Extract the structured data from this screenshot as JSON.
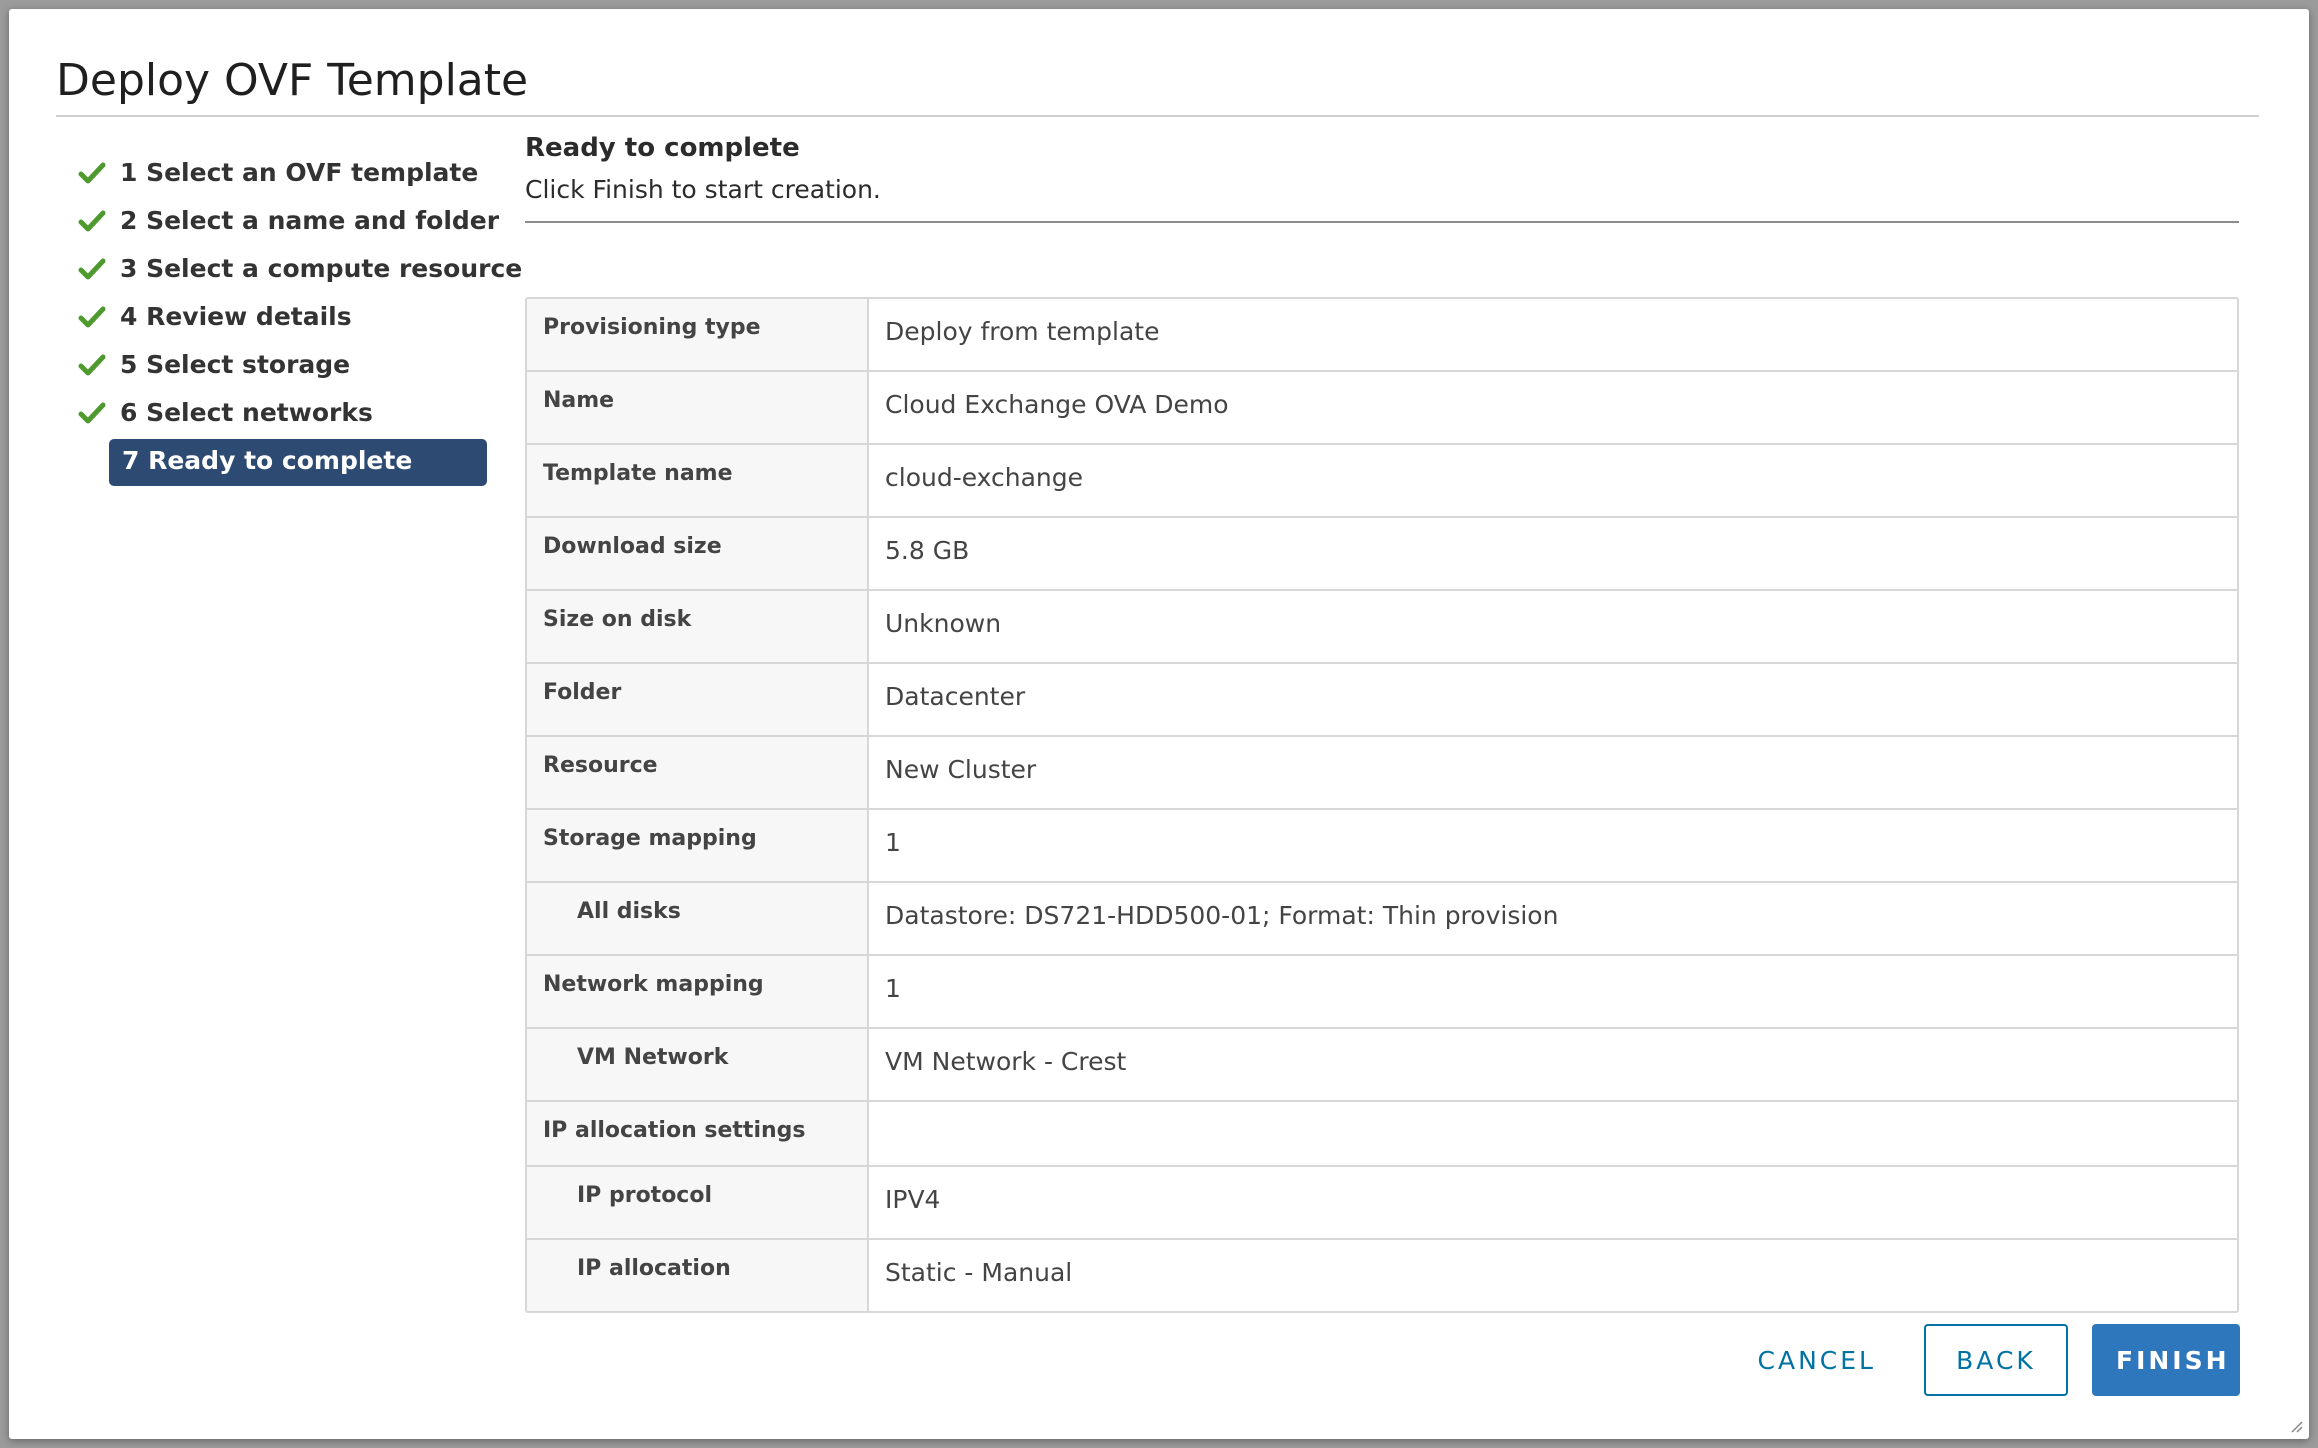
{
  "dialog": {
    "title": "Deploy OVF Template"
  },
  "steps": [
    {
      "label": "1 Select an OVF template",
      "done": true
    },
    {
      "label": "2 Select a name and folder",
      "done": true
    },
    {
      "label": "3 Select a compute resource",
      "done": true
    },
    {
      "label": "4 Review details",
      "done": true
    },
    {
      "label": "5 Select storage",
      "done": true
    },
    {
      "label": "6 Select networks",
      "done": true
    },
    {
      "label": "7 Ready to complete",
      "done": false,
      "active": true
    }
  ],
  "section": {
    "title": "Ready to complete",
    "subtitle": "Click Finish to start creation."
  },
  "summary": [
    {
      "key": "Provisioning type",
      "value": "Deploy from template"
    },
    {
      "key": "Name",
      "value": "Cloud Exchange OVA Demo"
    },
    {
      "key": "Template name",
      "value": "cloud-exchange"
    },
    {
      "key": "Download size",
      "value": "5.8 GB"
    },
    {
      "key": "Size on disk",
      "value": "Unknown"
    },
    {
      "key": "Folder",
      "value": "Datacenter"
    },
    {
      "key": "Resource",
      "value": "New Cluster"
    },
    {
      "key": "Storage mapping",
      "value": "1"
    },
    {
      "key": "All disks",
      "value": "Datastore: DS721-HDD500-01; Format: Thin provision"
    },
    {
      "key": "Network mapping",
      "value": "1"
    },
    {
      "key": "VM Network",
      "value": "VM Network - Crest"
    },
    {
      "key": "IP allocation settings",
      "value": ""
    },
    {
      "key": "IP protocol",
      "value": "IPV4"
    },
    {
      "key": "IP allocation",
      "value": "Static - Manual"
    }
  ],
  "buttons": {
    "cancel": "CANCEL",
    "back": "BACK",
    "finish": "FINISH"
  },
  "colors": {
    "check": "#4f9a2e",
    "active_step_bg": "#2d4a72",
    "primary": "#2e77bc",
    "link": "#0072a3"
  }
}
